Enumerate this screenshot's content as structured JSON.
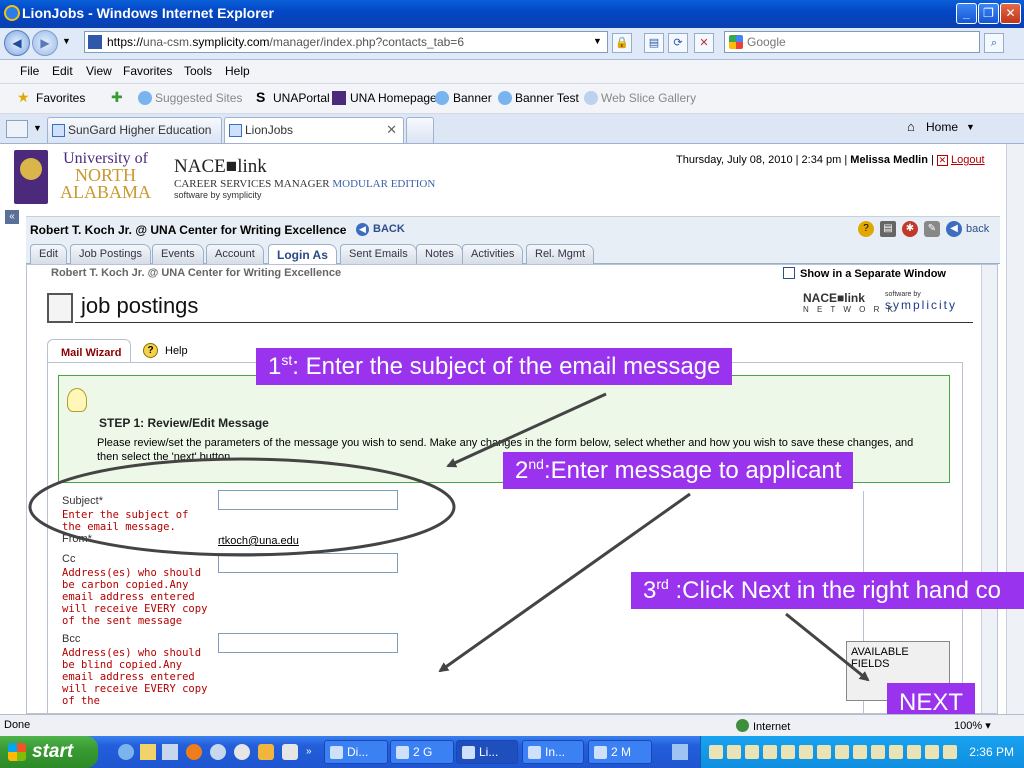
{
  "window": {
    "title": "LionJobs - Windows Internet Explorer"
  },
  "address_bar": {
    "url_prefix": "https://",
    "url_sub": "una-csm.",
    "url_domain": "symplicity.com",
    "url_path": "/manager/index.php?contacts_tab=6",
    "search_placeholder": "Google"
  },
  "menu": [
    "File",
    "Edit",
    "View",
    "Favorites",
    "Tools",
    "Help"
  ],
  "favorites_bar": {
    "favorites_label": "Favorites",
    "items": [
      "Suggested Sites",
      "UNAPortal",
      "UNA Homepage",
      "Banner",
      "Banner Test",
      "Web Slice Gallery"
    ]
  },
  "tabs": {
    "items": [
      "SunGard Higher Education",
      "LionJobs"
    ],
    "home_label": "Home"
  },
  "header": {
    "univ_line1": "University of",
    "univ_line2": "NORTH",
    "univ_line3": "ALABAMA",
    "nace_title": "NACE■link",
    "nace_sub_a": "CAREER SERVICES MANAGER",
    "nace_sub_b": "MODULAR EDITION",
    "nace_by": "software by symplicity",
    "date": "Thursday, July 08, 2010 | 2:34 pm |",
    "user": "Melissa Medlin",
    "sep": "|",
    "logout": "Logout"
  },
  "record": {
    "title": "Robert T. Koch Jr. @ UNA Center for Writing Excellence",
    "back": "BACK",
    "back_link": "back"
  },
  "profile_tabs": [
    "Edit",
    "Job Postings",
    "Events",
    "Account",
    "Login As",
    "Sent Emails",
    "Notes",
    "Activities",
    "Rel. Mgmt"
  ],
  "inner": {
    "title": "Robert T. Koch Jr. @ UNA Center for Writing Excellence",
    "separate_window": "Show in a Separate Window",
    "page_title": "job postings",
    "nace_network_a": "NACE■link",
    "nace_network_b": "N E T W O R K",
    "symp_small": "software by",
    "symp_big": "symplicity"
  },
  "wizard": {
    "tab": "Mail Wizard",
    "help": "Help",
    "step_heading": "STEP 1: Review/Edit Message",
    "step_text": "Please review/set the parameters of the message you wish to send. Make any changes in the form below, select whether and how you wish to save these changes, and then select the 'next' button.",
    "subject_label": "Subject*",
    "subject_hint": "Enter the subject of the email message.",
    "from_label": "From*",
    "from_value": "rtkoch@una.edu",
    "cc_label": "Cc",
    "cc_hint": "Address(es) who should be carbon copied.Any email address entered will receive EVERY copy of the sent message",
    "bcc_label": "Bcc",
    "bcc_hint": "Address(es) who should be blind copied.Any email address entered will receive EVERY copy of the",
    "available_fields": "AVAILABLE FIELDS"
  },
  "callouts": {
    "c1_num": "1",
    "c1_sup": "st",
    "c1_text": ": Enter the subject of the email message",
    "c2_num": "2",
    "c2_sup": "nd",
    "c2_text": ":Enter message to applicant",
    "c3_num": "3",
    "c3_sup": "rd",
    "c3_text": " :Click Next in the right hand co",
    "next": "NEXT"
  },
  "status": {
    "text": "Done",
    "zone": "Internet",
    "zoom": "100%"
  },
  "taskbar": {
    "start": "start",
    "tasks": [
      "Di...",
      "2 G",
      "Li...",
      "In...",
      "2 M"
    ],
    "time": "2:36 PM"
  },
  "colors": {
    "callout": "#9933ee",
    "una_purple": "#4b2a7b",
    "una_gold": "#c99a2e"
  }
}
